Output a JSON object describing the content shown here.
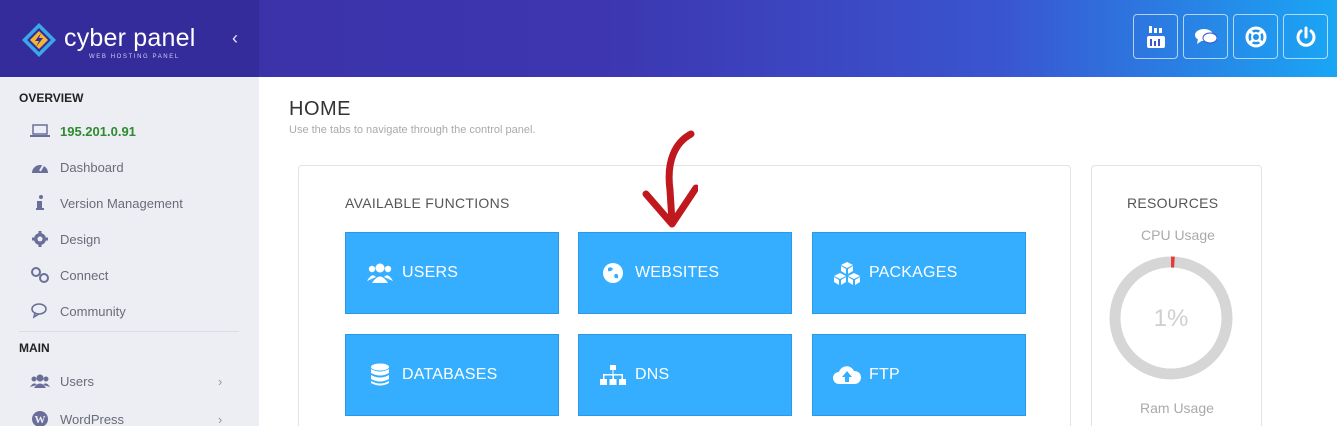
{
  "header": {
    "logo_text": "cyber panel",
    "logo_sub": "WEB HOSTING PANEL",
    "collapse_glyph": "‹",
    "buttons": [
      {
        "icon": "youtube-icon"
      },
      {
        "icon": "chat-icon"
      },
      {
        "icon": "lifebuoy-icon"
      },
      {
        "icon": "power-icon"
      }
    ]
  },
  "sidebar": {
    "overview_heading": "OVERVIEW",
    "main_heading": "MAIN",
    "items": [
      {
        "label": "195.201.0.91",
        "icon": "laptop-icon"
      },
      {
        "label": "Dashboard",
        "icon": "dashboard-icon"
      },
      {
        "label": "Version Management",
        "icon": "info-icon"
      },
      {
        "label": "Design",
        "icon": "gear-icon"
      },
      {
        "label": "Connect",
        "icon": "link-icon"
      },
      {
        "label": "Community",
        "icon": "comments-icon"
      },
      {
        "label": "Users",
        "icon": "users-icon",
        "chevron": "›"
      },
      {
        "label": "WordPress",
        "icon": "wordpress-icon",
        "chevron": "›"
      }
    ]
  },
  "main": {
    "title": "HOME",
    "subtitle": "Use the tabs to navigate through the control panel.",
    "functions_title": "AVAILABLE FUNCTIONS",
    "tiles": [
      {
        "label": "USERS",
        "icon": "users-icon"
      },
      {
        "label": "WEBSITES",
        "icon": "globe-icon"
      },
      {
        "label": "PACKAGES",
        "icon": "cubes-icon"
      },
      {
        "label": "DATABASES",
        "icon": "database-icon"
      },
      {
        "label": "DNS",
        "icon": "sitemap-icon"
      },
      {
        "label": "FTP",
        "icon": "cloud-upload-icon"
      }
    ]
  },
  "resources": {
    "title": "RESOURCES",
    "cpu_label": "CPU Usage",
    "cpu_value": "1%",
    "cpu_fraction": 0.01,
    "ram_label": "Ram Usage"
  },
  "colors": {
    "tile_blue": "#35aeff",
    "ip_green": "#2e8b2e",
    "arrow_red": "#c0181f",
    "gauge_track": "#d6d6d6",
    "gauge_fill": "#e33b3b"
  }
}
